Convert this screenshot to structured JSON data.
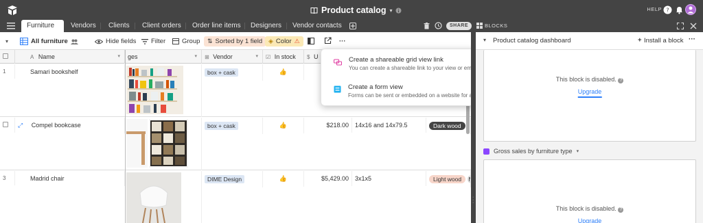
{
  "topbar": {
    "title": "Product catalog",
    "help_label": "HELP"
  },
  "tabs": [
    {
      "label": "Furniture"
    },
    {
      "label": "Vendors"
    },
    {
      "label": "Clients"
    },
    {
      "label": "Client orders"
    },
    {
      "label": "Order line items"
    },
    {
      "label": "Designers"
    },
    {
      "label": "Vendor contacts"
    }
  ],
  "share_label": "SHARE",
  "blocks_label": "BLOCKS",
  "viewbar": {
    "view_name": "All furniture",
    "hide_fields": "Hide fields",
    "filter": "Filter",
    "group": "Group",
    "sorted": "Sorted by 1 field",
    "color": "Color",
    "more": "···"
  },
  "columns": [
    {
      "label": "Name"
    },
    {
      "label": "ges"
    },
    {
      "label": "Vendor"
    },
    {
      "label": "In stock"
    },
    {
      "label": "U"
    }
  ],
  "rows": [
    {
      "num": "1",
      "name": "Samari bookshelf",
      "vendor": "box + cask",
      "in_stock": "👍",
      "price": "",
      "size": "",
      "material": ""
    },
    {
      "num": "",
      "name": "Compel bookcase",
      "vendor": "box + cask",
      "in_stock": "👍",
      "price": "$218.00",
      "size": "14x16 and 14x79.5",
      "material": "Dark wood"
    },
    {
      "num": "3",
      "name": "Madrid chair",
      "vendor": "DIME Design",
      "in_stock": "👍",
      "price": "$5,429.00",
      "size": "3x1x5",
      "material": "Light wood",
      "material2": "M"
    }
  ],
  "popover": {
    "item1_title": "Create a shareable grid view link",
    "item1_sub": "You can create a shareable link to your view or embed it on a website",
    "item2_title": "Create a form view",
    "item2_sub": "Forms can be sent or embedded on a website for anyone to fill out"
  },
  "rightpanel": {
    "title": "Product catalog dashboard",
    "install": "Install a block",
    "card1_disabled": "This block is disabled.",
    "card1_upgrade": "Upgrade",
    "card2_title": "Gross sales by furniture type",
    "card2_disabled": "This block is disabled.",
    "card2_upgrade": "Upgrade"
  },
  "colors": {
    "topbar": "#444444",
    "sorted_bg": "#fbe3d4",
    "color_bg": "#fbe9b6",
    "upgrade_blue": "#2d7ff9",
    "dark_chip": "#444444",
    "light_chip": "#f7d5c9"
  }
}
